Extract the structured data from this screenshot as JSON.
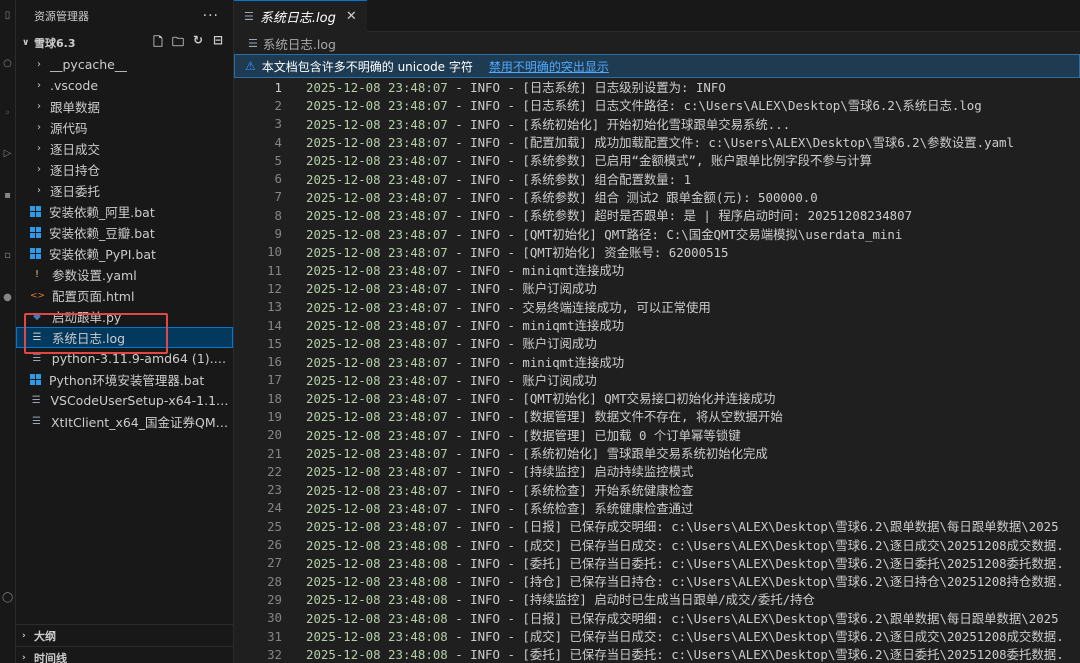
{
  "sidebar": {
    "title": "资源管理器",
    "more": "···",
    "folder": "雪球6.3",
    "items": [
      {
        "type": "folder",
        "name": "__pycache__"
      },
      {
        "type": "folder",
        "name": ".vscode"
      },
      {
        "type": "folder",
        "name": "跟单数据"
      },
      {
        "type": "folder",
        "name": "源代码"
      },
      {
        "type": "folder",
        "name": "逐日成交"
      },
      {
        "type": "folder",
        "name": "逐日持仓"
      },
      {
        "type": "folder",
        "name": "逐日委托"
      },
      {
        "type": "bat",
        "name": "安装依赖_阿里.bat"
      },
      {
        "type": "bat",
        "name": "安装依赖_豆瓣.bat"
      },
      {
        "type": "bat",
        "name": "安装依赖_PyPI.bat"
      },
      {
        "type": "yaml",
        "name": "参数设置.yaml"
      },
      {
        "type": "html",
        "name": "配置页面.html"
      },
      {
        "type": "py",
        "name": "启动跟单.py"
      },
      {
        "type": "log",
        "name": "系统日志.log"
      },
      {
        "type": "exe",
        "name": "python-3.11.9-amd64 (1).exe"
      },
      {
        "type": "bat",
        "name": "Python环境安装管理器.bat"
      },
      {
        "type": "exe",
        "name": "VSCodeUserSetup-x64-1.106.3..."
      },
      {
        "type": "exe",
        "name": "XtItClient_x64_国金证券QMT模..."
      }
    ],
    "outline": "大纲",
    "timeline": "时间线"
  },
  "editor": {
    "tab_label": "系统日志.log",
    "breadcrumb": "系统日志.log",
    "banner_text": "本文档包含许多不明确的 unicode 字符",
    "banner_link": "禁用不明确的突出显示"
  },
  "log_lines": [
    {
      "n": "1",
      "ts": "2025-12-08 23:48:07",
      "lv": "INFO",
      "text": "[日志系统] 日志级别设置为: INFO"
    },
    {
      "n": "2",
      "ts": "2025-12-08 23:48:07",
      "lv": "INFO",
      "text": "[日志系统] 日志文件路径: c:\\Users\\ALEX\\Desktop\\雪球6.2\\系统日志.log"
    },
    {
      "n": "3",
      "ts": "2025-12-08 23:48:07",
      "lv": "INFO",
      "text": "[系统初始化] 开始初始化雪球跟单交易系统..."
    },
    {
      "n": "4",
      "ts": "2025-12-08 23:48:07",
      "lv": "INFO",
      "text": "[配置加载] 成功加载配置文件: c:\\Users\\ALEX\\Desktop\\雪球6.2\\参数设置.yaml"
    },
    {
      "n": "5",
      "ts": "2025-12-08 23:48:07",
      "lv": "INFO",
      "text": "[系统参数] 已启用“金额模式”, 账户跟单比例字段不参与计算"
    },
    {
      "n": "6",
      "ts": "2025-12-08 23:48:07",
      "lv": "INFO",
      "text": "[系统参数] 组合配置数量: 1"
    },
    {
      "n": "7",
      "ts": "2025-12-08 23:48:07",
      "lv": "INFO",
      "text": "[系统参数] 组合 测试2 跟单金额(元): 500000.0"
    },
    {
      "n": "8",
      "ts": "2025-12-08 23:48:07",
      "lv": "INFO",
      "text": "[系统参数] 超时是否跟单: 是 | 程序启动时间: 20251208234807"
    },
    {
      "n": "9",
      "ts": "2025-12-08 23:48:07",
      "lv": "INFO",
      "text": "[QMT初始化] QMT路径: C:\\国金QMT交易端模拟\\userdata_mini"
    },
    {
      "n": "10",
      "ts": "2025-12-08 23:48:07",
      "lv": "INFO",
      "text": "[QMT初始化] 资金账号: 62000515"
    },
    {
      "n": "11",
      "ts": "2025-12-08 23:48:07",
      "lv": "INFO",
      "text": "miniqmt连接成功"
    },
    {
      "n": "12",
      "ts": "2025-12-08 23:48:07",
      "lv": "INFO",
      "text": "账户订阅成功"
    },
    {
      "n": "13",
      "ts": "2025-12-08 23:48:07",
      "lv": "INFO",
      "text": "交易终端连接成功, 可以正常使用"
    },
    {
      "n": "14",
      "ts": "2025-12-08 23:48:07",
      "lv": "INFO",
      "text": "miniqmt连接成功"
    },
    {
      "n": "15",
      "ts": "2025-12-08 23:48:07",
      "lv": "INFO",
      "text": "账户订阅成功"
    },
    {
      "n": "16",
      "ts": "2025-12-08 23:48:07",
      "lv": "INFO",
      "text": "miniqmt连接成功"
    },
    {
      "n": "17",
      "ts": "2025-12-08 23:48:07",
      "lv": "INFO",
      "text": "账户订阅成功"
    },
    {
      "n": "18",
      "ts": "2025-12-08 23:48:07",
      "lv": "INFO",
      "text": "[QMT初始化] QMT交易接口初始化并连接成功"
    },
    {
      "n": "19",
      "ts": "2025-12-08 23:48:07",
      "lv": "INFO",
      "text": "[数据管理] 数据文件不存在, 将从空数据开始"
    },
    {
      "n": "20",
      "ts": "2025-12-08 23:48:07",
      "lv": "INFO",
      "text": "[数据管理] 已加载 0 个订单幂等锁键"
    },
    {
      "n": "21",
      "ts": "2025-12-08 23:48:07",
      "lv": "INFO",
      "text": "[系统初始化] 雪球跟单交易系统初始化完成"
    },
    {
      "n": "22",
      "ts": "2025-12-08 23:48:07",
      "lv": "INFO",
      "text": "[持续监控] 启动持续监控模式"
    },
    {
      "n": "23",
      "ts": "2025-12-08 23:48:07",
      "lv": "INFO",
      "text": "[系统检查] 开始系统健康检查"
    },
    {
      "n": "24",
      "ts": "2025-12-08 23:48:07",
      "lv": "INFO",
      "text": "[系统检查] 系统健康检查通过"
    },
    {
      "n": "25",
      "ts": "2025-12-08 23:48:07",
      "lv": "INFO",
      "text": "[日报] 已保存成交明细: c:\\Users\\ALEX\\Desktop\\雪球6.2\\跟单数据\\每日跟单数据\\2025"
    },
    {
      "n": "26",
      "ts": "2025-12-08 23:48:08",
      "lv": "INFO",
      "text": "[成交] 已保存当日成交: c:\\Users\\ALEX\\Desktop\\雪球6.2\\逐日成交\\20251208成交数据."
    },
    {
      "n": "27",
      "ts": "2025-12-08 23:48:08",
      "lv": "INFO",
      "text": "[委托] 已保存当日委托: c:\\Users\\ALEX\\Desktop\\雪球6.2\\逐日委托\\20251208委托数据."
    },
    {
      "n": "28",
      "ts": "2025-12-08 23:48:08",
      "lv": "INFO",
      "text": "[持仓] 已保存当日持仓: c:\\Users\\ALEX\\Desktop\\雪球6.2\\逐日持仓\\20251208持仓数据."
    },
    {
      "n": "29",
      "ts": "2025-12-08 23:48:08",
      "lv": "INFO",
      "text": "[持续监控] 启动时已生成当日跟单/成交/委托/持仓"
    },
    {
      "n": "30",
      "ts": "2025-12-08 23:48:08",
      "lv": "INFO",
      "text": "[日报] 已保存成交明细: c:\\Users\\ALEX\\Desktop\\雪球6.2\\跟单数据\\每日跟单数据\\2025"
    },
    {
      "n": "31",
      "ts": "2025-12-08 23:48:08",
      "lv": "INFO",
      "text": "[成交] 已保存当日成交: c:\\Users\\ALEX\\Desktop\\雪球6.2\\逐日成交\\20251208成交数据."
    },
    {
      "n": "32",
      "ts": "2025-12-08 23:48:08",
      "lv": "INFO",
      "text": "[委托] 已保存当日委托: c:\\Users\\ALEX\\Desktop\\雪球6.2\\逐日委托\\20251208委托数据."
    }
  ]
}
